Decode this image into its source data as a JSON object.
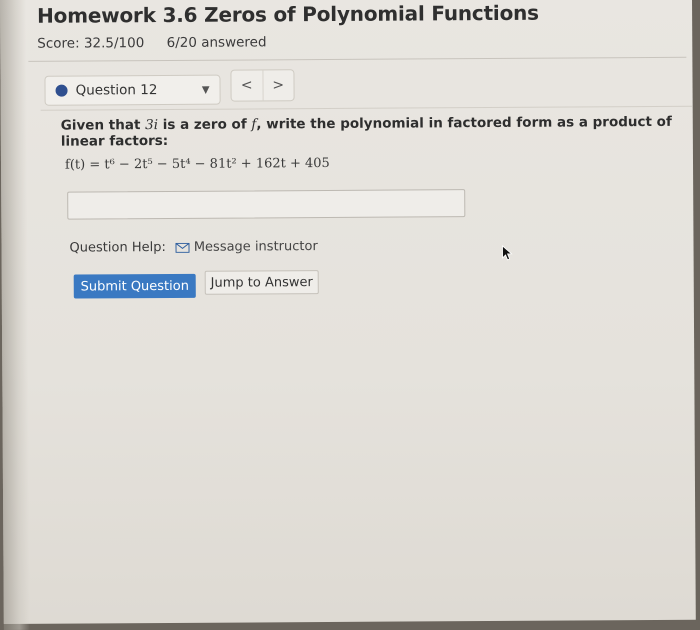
{
  "header": {
    "title": "Homework 3.6 Zeros of Polynomial Functions",
    "score": "Score: 32.5/100",
    "answered": "6/20 answered"
  },
  "question_nav": {
    "current": "Question 12",
    "prev_label": "<",
    "next_label": ">"
  },
  "question": {
    "prompt_pre": "Given that ",
    "prompt_zero": "3i",
    "prompt_mid": " is a zero of ",
    "prompt_fn": "f",
    "prompt_post": ", write the polynomial in factored form as a product of linear factors:",
    "formula": "f(t) = t⁶ − 2t⁵ − 5t⁴ − 81t² + 162t + 405",
    "answer_value": ""
  },
  "help": {
    "label": "Question Help:",
    "message_link": "Message instructor"
  },
  "actions": {
    "submit_label": "Submit Question",
    "jump_label": "Jump to Answer"
  },
  "colors": {
    "accent": "#3a79c2",
    "status_dot": "#2f4f8f"
  }
}
